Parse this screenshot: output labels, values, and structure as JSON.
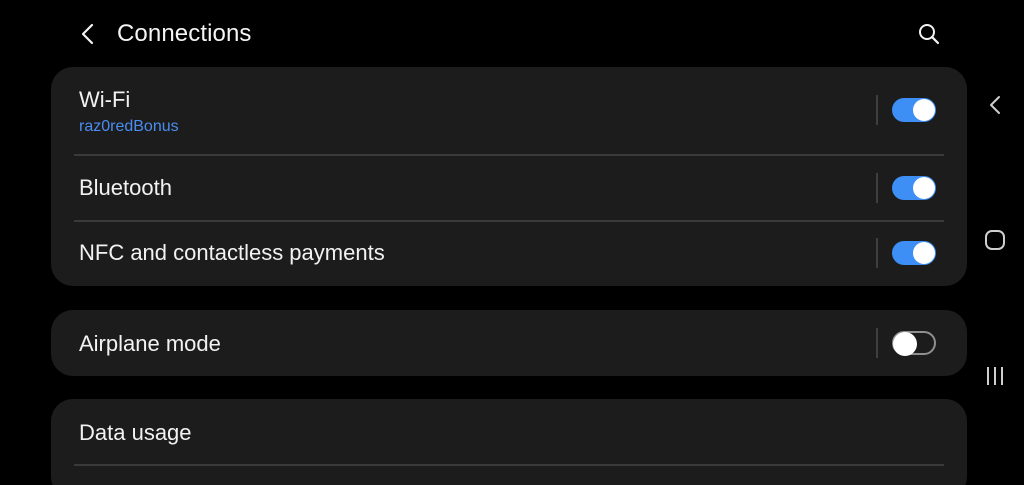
{
  "header": {
    "title": "Connections",
    "back_icon": "chevron-left-icon",
    "search_icon": "search-icon"
  },
  "connections_card": {
    "wifi": {
      "label": "Wi-Fi",
      "network": "raz0redBonus",
      "toggle_on": true
    },
    "bluetooth": {
      "label": "Bluetooth",
      "toggle_on": true
    },
    "nfc": {
      "label": "NFC and contactless payments",
      "toggle_on": true
    }
  },
  "airplane_card": {
    "airplane": {
      "label": "Airplane mode",
      "toggle_on": false
    }
  },
  "data_card": {
    "data_usage": {
      "label": "Data usage"
    }
  },
  "nav_bar": {
    "back_icon": "nav-back-icon",
    "home_icon": "nav-home-icon",
    "recents_icon": "nav-recents-icon"
  },
  "colors": {
    "background": "#000000",
    "card": "#1c1c1c",
    "accent": "#3e8ff5",
    "subtext": "#4a8df0"
  }
}
